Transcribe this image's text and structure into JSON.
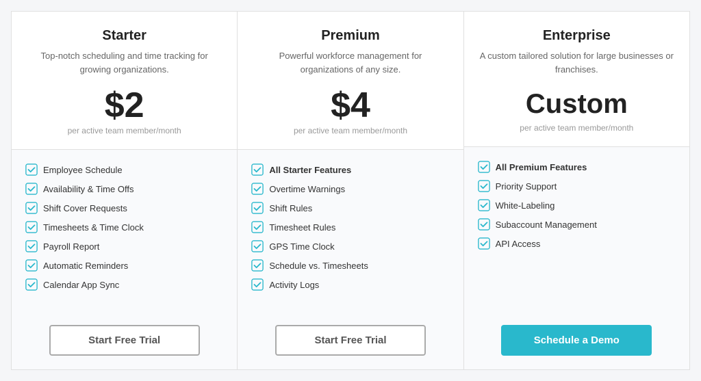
{
  "plans": [
    {
      "id": "starter",
      "name": "Starter",
      "description": "Top-notch scheduling and time tracking for growing organizations.",
      "price": "$2",
      "price_period": "per active team member/month",
      "features": [
        {
          "text": "Employee Schedule",
          "bold": false
        },
        {
          "text": "Availability & Time Offs",
          "bold": false
        },
        {
          "text": "Shift Cover Requests",
          "bold": false
        },
        {
          "text": "Timesheets & Time Clock",
          "bold": false
        },
        {
          "text": "Payroll Report",
          "bold": false
        },
        {
          "text": "Automatic Reminders",
          "bold": false
        },
        {
          "text": "Calendar App Sync",
          "bold": false
        }
      ],
      "cta_label": "Start Free Trial",
      "cta_type": "outline"
    },
    {
      "id": "premium",
      "name": "Premium",
      "description": "Powerful workforce management for organizations of any size.",
      "price": "$4",
      "price_period": "per active team member/month",
      "features": [
        {
          "text": "All Starter Features",
          "bold": true
        },
        {
          "text": "Overtime Warnings",
          "bold": false
        },
        {
          "text": "Shift Rules",
          "bold": false
        },
        {
          "text": "Timesheet Rules",
          "bold": false
        },
        {
          "text": "GPS Time Clock",
          "bold": false
        },
        {
          "text": "Schedule vs. Timesheets",
          "bold": false
        },
        {
          "text": "Activity Logs",
          "bold": false
        }
      ],
      "cta_label": "Start Free Trial",
      "cta_type": "outline"
    },
    {
      "id": "enterprise",
      "name": "Enterprise",
      "description": "A custom tailored solution for large businesses or franchises.",
      "price": "Custom",
      "price_period": "per active team member/month",
      "features": [
        {
          "text": "All Premium Features",
          "bold": true
        },
        {
          "text": "Priority Support",
          "bold": false
        },
        {
          "text": "White-Labeling",
          "bold": false
        },
        {
          "text": "Subaccount Management",
          "bold": false
        },
        {
          "text": "API Access",
          "bold": false
        }
      ],
      "cta_label": "Schedule a Demo",
      "cta_type": "primary"
    }
  ],
  "check_symbol": "✔"
}
